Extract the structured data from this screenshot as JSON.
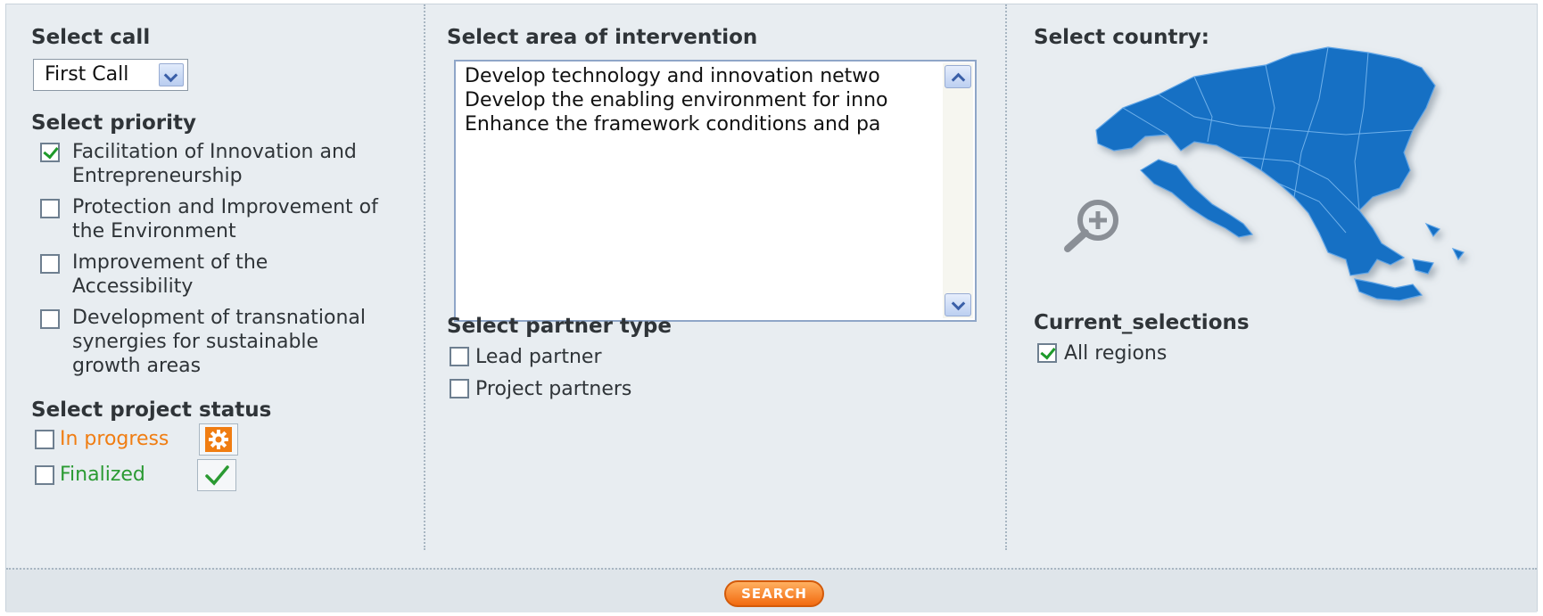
{
  "call": {
    "heading": "Select call",
    "selected": "First Call"
  },
  "priority": {
    "heading": "Select priority",
    "items": [
      {
        "line1": "Facilitation of Innovation and",
        "line2": "Entrepreneurship",
        "line3": "",
        "checked": true
      },
      {
        "line1": "Protection and Improvement of",
        "line2": "the Environment",
        "line3": "",
        "checked": false
      },
      {
        "line1": "Improvement of the",
        "line2": "Accessibility",
        "line3": "",
        "checked": false
      },
      {
        "line1": "Development of transnational",
        "line2": "synergies for sustainable",
        "line3": "growth areas",
        "checked": false
      }
    ]
  },
  "status": {
    "heading": "Select project status",
    "in_progress": "In progress",
    "finalized": "Finalized",
    "in_progress_color": "#f07d12",
    "finalized_color": "#2a9a32"
  },
  "intervention": {
    "heading": "Select area of intervention",
    "items": [
      "Develop technology and innovation netwo",
      "Develop the enabling environment for inno",
      "Enhance the framework conditions and pa"
    ]
  },
  "partner": {
    "heading": "Select partner type",
    "lead": "Lead partner",
    "project": "Project partners"
  },
  "country": {
    "heading": "Select country:",
    "current_heading": "Current_selections",
    "all_regions": "All regions"
  },
  "search": {
    "label": "SEARCH"
  },
  "colors": {
    "map_blue": "#1670c4",
    "accent_orange": "#f26a10"
  }
}
